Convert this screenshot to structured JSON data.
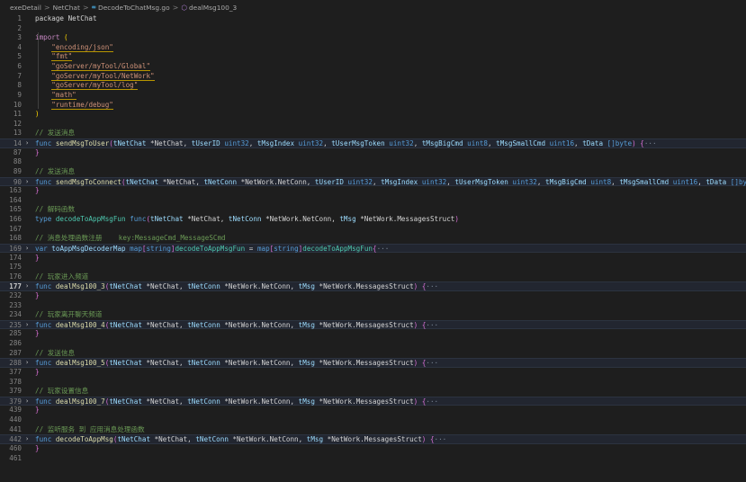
{
  "breadcrumb": {
    "items": [
      {
        "label": "exeDetail",
        "icon": "none"
      },
      {
        "label": "NetChat",
        "icon": "none"
      },
      {
        "label": "DecodeToChatMsg.go",
        "icon": "go-file-icon"
      },
      {
        "label": "dealMsg100_3",
        "icon": "function-symbol-icon"
      }
    ],
    "separator": ">"
  },
  "colors": {
    "background": "#1e1e1e",
    "keyword": "#569cd6",
    "function": "#dcdcaa",
    "type": "#4ec9b0",
    "string": "#ce9178",
    "comment": "#6a9955",
    "line_number": "#858585"
  },
  "editor": {
    "active_line": "177",
    "lines": [
      {
        "n": "1",
        "tokens": [
          {
            "t": "package NetChat",
            "c": "pl"
          }
        ]
      },
      {
        "n": "2",
        "tokens": []
      },
      {
        "n": "3",
        "tokens": [
          {
            "t": "import ",
            "c": "kw2"
          },
          {
            "t": "(",
            "c": "br"
          }
        ]
      },
      {
        "n": "4",
        "tokens": [
          {
            "t": "    ",
            "c": "pl"
          },
          {
            "t": "\"encoding/json\"",
            "c": "str sq"
          }
        ]
      },
      {
        "n": "5",
        "tokens": [
          {
            "t": "    ",
            "c": "pl"
          },
          {
            "t": "\"fmt\"",
            "c": "str sq"
          }
        ]
      },
      {
        "n": "6",
        "tokens": [
          {
            "t": "    ",
            "c": "pl"
          },
          {
            "t": "\"goServer/myTool/Global\"",
            "c": "str sq"
          }
        ]
      },
      {
        "n": "7",
        "tokens": [
          {
            "t": "    ",
            "c": "pl"
          },
          {
            "t": "\"goServer/myTool/NetWork\"",
            "c": "str sq"
          }
        ]
      },
      {
        "n": "8",
        "tokens": [
          {
            "t": "    ",
            "c": "pl"
          },
          {
            "t": "\"goServer/myTool/log\"",
            "c": "str sq"
          }
        ]
      },
      {
        "n": "9",
        "tokens": [
          {
            "t": "    ",
            "c": "pl"
          },
          {
            "t": "\"math\"",
            "c": "str sq"
          }
        ]
      },
      {
        "n": "10",
        "tokens": [
          {
            "t": "    ",
            "c": "pl"
          },
          {
            "t": "\"runtime/debug\"",
            "c": "str sq"
          }
        ]
      },
      {
        "n": "11",
        "tokens": [
          {
            "t": ")",
            "c": "br"
          }
        ]
      },
      {
        "n": "12",
        "tokens": []
      },
      {
        "n": "13",
        "tokens": [
          {
            "t": "// 发送消息",
            "c": "cm"
          }
        ]
      },
      {
        "n": "14",
        "fold": "›",
        "hl": true,
        "tokens": [
          {
            "t": "func ",
            "c": "kw"
          },
          {
            "t": "sendMsgToUser",
            "c": "fn"
          },
          {
            "t": "(",
            "c": "br2"
          },
          {
            "t": "tNetChat ",
            "c": "var"
          },
          {
            "t": "*NetChat, ",
            "c": "pl"
          },
          {
            "t": "tUserID ",
            "c": "var"
          },
          {
            "t": "uint32",
            "c": "kw"
          },
          {
            "t": ", ",
            "c": "pl"
          },
          {
            "t": "tMsgIndex ",
            "c": "var"
          },
          {
            "t": "uint32",
            "c": "kw"
          },
          {
            "t": ", ",
            "c": "pl"
          },
          {
            "t": "tUserMsgToken ",
            "c": "var"
          },
          {
            "t": "uint32",
            "c": "kw"
          },
          {
            "t": ", ",
            "c": "pl"
          },
          {
            "t": "tMsgBigCmd ",
            "c": "var"
          },
          {
            "t": "uint8",
            "c": "kw"
          },
          {
            "t": ", ",
            "c": "pl"
          },
          {
            "t": "tMsgSmallCmd ",
            "c": "var"
          },
          {
            "t": "uint16",
            "c": "kw"
          },
          {
            "t": ", ",
            "c": "pl"
          },
          {
            "t": "tData ",
            "c": "var"
          },
          {
            "t": "[]",
            "c": "kw"
          },
          {
            "t": "byte",
            "c": "kw"
          },
          {
            "t": ") ",
            "c": "br2"
          },
          {
            "t": "{",
            "c": "br2"
          },
          {
            "t": "···",
            "c": "ellipsis"
          }
        ]
      },
      {
        "n": "87",
        "tokens": [
          {
            "t": "}",
            "c": "br2"
          }
        ]
      },
      {
        "n": "88",
        "tokens": []
      },
      {
        "n": "89",
        "tokens": [
          {
            "t": "// 发送消息",
            "c": "cm"
          }
        ]
      },
      {
        "n": "90",
        "fold": "›",
        "hl": true,
        "tokens": [
          {
            "t": "func ",
            "c": "kw"
          },
          {
            "t": "sendMsgToConnect",
            "c": "fn"
          },
          {
            "t": "(",
            "c": "br2"
          },
          {
            "t": "tNetChat ",
            "c": "var"
          },
          {
            "t": "*NetChat, ",
            "c": "pl"
          },
          {
            "t": "tNetConn ",
            "c": "var"
          },
          {
            "t": "*NetWork.NetConn, ",
            "c": "pl"
          },
          {
            "t": "tUserID ",
            "c": "var"
          },
          {
            "t": "uint32",
            "c": "kw"
          },
          {
            "t": ", ",
            "c": "pl"
          },
          {
            "t": "tMsgIndex ",
            "c": "var"
          },
          {
            "t": "uint32",
            "c": "kw"
          },
          {
            "t": ", ",
            "c": "pl"
          },
          {
            "t": "tUserMsgToken ",
            "c": "var"
          },
          {
            "t": "uint32",
            "c": "kw"
          },
          {
            "t": ", ",
            "c": "pl"
          },
          {
            "t": "tMsgBigCmd ",
            "c": "var"
          },
          {
            "t": "uint8",
            "c": "kw"
          },
          {
            "t": ", ",
            "c": "pl"
          },
          {
            "t": "tMsgSmallCmd ",
            "c": "var"
          },
          {
            "t": "uint16",
            "c": "kw"
          },
          {
            "t": ", ",
            "c": "pl"
          },
          {
            "t": "tData ",
            "c": "var"
          },
          {
            "t": "[]",
            "c": "kw"
          },
          {
            "t": "byte",
            "c": "kw"
          },
          {
            "t": ") ",
            "c": "br2"
          },
          {
            "t": "{",
            "c": "br2"
          },
          {
            "t": "···",
            "c": "ellipsis"
          }
        ]
      },
      {
        "n": "163",
        "tokens": [
          {
            "t": "}",
            "c": "br2"
          }
        ]
      },
      {
        "n": "164",
        "tokens": []
      },
      {
        "n": "165",
        "tokens": [
          {
            "t": "// 解码函数",
            "c": "cm"
          }
        ]
      },
      {
        "n": "166",
        "tokens": [
          {
            "t": "type ",
            "c": "kw"
          },
          {
            "t": "decodeToAppMsgFun ",
            "c": "ty"
          },
          {
            "t": "func",
            "c": "kw"
          },
          {
            "t": "(",
            "c": "br2"
          },
          {
            "t": "tNetChat ",
            "c": "var"
          },
          {
            "t": "*NetChat, ",
            "c": "pl"
          },
          {
            "t": "tNetConn ",
            "c": "var"
          },
          {
            "t": "*NetWork.NetConn, ",
            "c": "pl"
          },
          {
            "t": "tMsg ",
            "c": "var"
          },
          {
            "t": "*NetWork.MessagesStruct",
            "c": "pl"
          },
          {
            "t": ")",
            "c": "br2"
          }
        ]
      },
      {
        "n": "167",
        "tokens": []
      },
      {
        "n": "168",
        "tokens": [
          {
            "t": "// 消息处理函数注册    key:MessageCmd_MessageSCmd",
            "c": "cm"
          }
        ]
      },
      {
        "n": "169",
        "fold": "›",
        "hl": true,
        "tokens": [
          {
            "t": "var ",
            "c": "kw"
          },
          {
            "t": "toAppMsgDecoderMap ",
            "c": "var"
          },
          {
            "t": "map",
            "c": "kw"
          },
          {
            "t": "[",
            "c": "br2"
          },
          {
            "t": "string",
            "c": "kw"
          },
          {
            "t": "]",
            "c": "br2"
          },
          {
            "t": "decodeToAppMsgFun",
            "c": "ty"
          },
          {
            "t": " = ",
            "c": "pl"
          },
          {
            "t": "map",
            "c": "kw"
          },
          {
            "t": "[",
            "c": "br2"
          },
          {
            "t": "string",
            "c": "kw"
          },
          {
            "t": "]",
            "c": "br2"
          },
          {
            "t": "decodeToAppMsgFun",
            "c": "ty"
          },
          {
            "t": "{",
            "c": "br2"
          },
          {
            "t": "···",
            "c": "ellipsis"
          }
        ]
      },
      {
        "n": "174",
        "tokens": [
          {
            "t": "}",
            "c": "br2"
          }
        ]
      },
      {
        "n": "175",
        "tokens": []
      },
      {
        "n": "176",
        "tokens": [
          {
            "t": "// 玩家进入频道",
            "c": "cm"
          }
        ]
      },
      {
        "n": "177",
        "fold": "›",
        "hl": true,
        "tokens": [
          {
            "t": "func ",
            "c": "kw"
          },
          {
            "t": "dealMsg100_3",
            "c": "fn"
          },
          {
            "t": "(",
            "c": "br2"
          },
          {
            "t": "tNetChat ",
            "c": "var"
          },
          {
            "t": "*NetChat, ",
            "c": "pl"
          },
          {
            "t": "tNetConn ",
            "c": "var"
          },
          {
            "t": "*NetWork.NetConn, ",
            "c": "pl"
          },
          {
            "t": "tMsg ",
            "c": "var"
          },
          {
            "t": "*NetWork.MessagesStruct",
            "c": "pl"
          },
          {
            "t": ") ",
            "c": "br2"
          },
          {
            "t": "{",
            "c": "br2"
          },
          {
            "t": "···",
            "c": "ellipsis"
          }
        ]
      },
      {
        "n": "232",
        "tokens": [
          {
            "t": "}",
            "c": "br2"
          }
        ]
      },
      {
        "n": "233",
        "tokens": []
      },
      {
        "n": "234",
        "tokens": [
          {
            "t": "// 玩家离开聊天频道",
            "c": "cm"
          }
        ]
      },
      {
        "n": "235",
        "fold": "›",
        "hl": true,
        "tokens": [
          {
            "t": "func ",
            "c": "kw"
          },
          {
            "t": "dealMsg100_4",
            "c": "fn"
          },
          {
            "t": "(",
            "c": "br2"
          },
          {
            "t": "tNetChat ",
            "c": "var"
          },
          {
            "t": "*NetChat, ",
            "c": "pl"
          },
          {
            "t": "tNetConn ",
            "c": "var"
          },
          {
            "t": "*NetWork.NetConn, ",
            "c": "pl"
          },
          {
            "t": "tMsg ",
            "c": "var"
          },
          {
            "t": "*NetWork.MessagesStruct",
            "c": "pl"
          },
          {
            "t": ") ",
            "c": "br2"
          },
          {
            "t": "{",
            "c": "br2"
          },
          {
            "t": "···",
            "c": "ellipsis"
          }
        ]
      },
      {
        "n": "285",
        "tokens": [
          {
            "t": "}",
            "c": "br2"
          }
        ]
      },
      {
        "n": "286",
        "tokens": []
      },
      {
        "n": "287",
        "tokens": [
          {
            "t": "// 发送信息",
            "c": "cm"
          }
        ]
      },
      {
        "n": "288",
        "fold": "›",
        "hl": true,
        "tokens": [
          {
            "t": "func ",
            "c": "kw"
          },
          {
            "t": "dealMsg100_5",
            "c": "fn"
          },
          {
            "t": "(",
            "c": "br2"
          },
          {
            "t": "tNetChat ",
            "c": "var"
          },
          {
            "t": "*NetChat, ",
            "c": "pl"
          },
          {
            "t": "tNetConn ",
            "c": "var"
          },
          {
            "t": "*NetWork.NetConn, ",
            "c": "pl"
          },
          {
            "t": "tMsg ",
            "c": "var"
          },
          {
            "t": "*NetWork.MessagesStruct",
            "c": "pl"
          },
          {
            "t": ") ",
            "c": "br2"
          },
          {
            "t": "{",
            "c": "br2"
          },
          {
            "t": "···",
            "c": "ellipsis"
          }
        ]
      },
      {
        "n": "377",
        "tokens": [
          {
            "t": "}",
            "c": "br2"
          }
        ]
      },
      {
        "n": "378",
        "tokens": []
      },
      {
        "n": "379",
        "tokens": [
          {
            "t": "// 玩家设置信息",
            "c": "cm"
          }
        ]
      },
      {
        "n": "379",
        "fold": "›",
        "hl": true,
        "tokens": [
          {
            "t": "func ",
            "c": "kw"
          },
          {
            "t": "dealMsg100_7",
            "c": "fn"
          },
          {
            "t": "(",
            "c": "br2"
          },
          {
            "t": "tNetChat ",
            "c": "var"
          },
          {
            "t": "*NetChat, ",
            "c": "pl"
          },
          {
            "t": "tNetConn ",
            "c": "var"
          },
          {
            "t": "*NetWork.NetConn, ",
            "c": "pl"
          },
          {
            "t": "tMsg ",
            "c": "var"
          },
          {
            "t": "*NetWork.MessagesStruct",
            "c": "pl"
          },
          {
            "t": ") ",
            "c": "br2"
          },
          {
            "t": "{",
            "c": "br2"
          },
          {
            "t": "···",
            "c": "ellipsis"
          }
        ]
      },
      {
        "n": "439",
        "tokens": [
          {
            "t": "}",
            "c": "br2"
          }
        ]
      },
      {
        "n": "440",
        "tokens": []
      },
      {
        "n": "441",
        "tokens": [
          {
            "t": "// 监听服务 到 应用消息处理函数",
            "c": "cm"
          }
        ]
      },
      {
        "n": "442",
        "fold": "›",
        "hl": true,
        "tokens": [
          {
            "t": "func ",
            "c": "kw"
          },
          {
            "t": "decodeToAppMsg",
            "c": "fn"
          },
          {
            "t": "(",
            "c": "br2"
          },
          {
            "t": "tNetChat ",
            "c": "var"
          },
          {
            "t": "*NetChat, ",
            "c": "pl"
          },
          {
            "t": "tNetConn ",
            "c": "var"
          },
          {
            "t": "*NetWork.NetConn, ",
            "c": "pl"
          },
          {
            "t": "tMsg ",
            "c": "var"
          },
          {
            "t": "*NetWork.MessagesStruct",
            "c": "pl"
          },
          {
            "t": ") ",
            "c": "br2"
          },
          {
            "t": "{",
            "c": "br2"
          },
          {
            "t": "···",
            "c": "ellipsis"
          }
        ]
      },
      {
        "n": "460",
        "tokens": [
          {
            "t": "}",
            "c": "br2"
          }
        ]
      },
      {
        "n": "461",
        "tokens": []
      }
    ]
  }
}
